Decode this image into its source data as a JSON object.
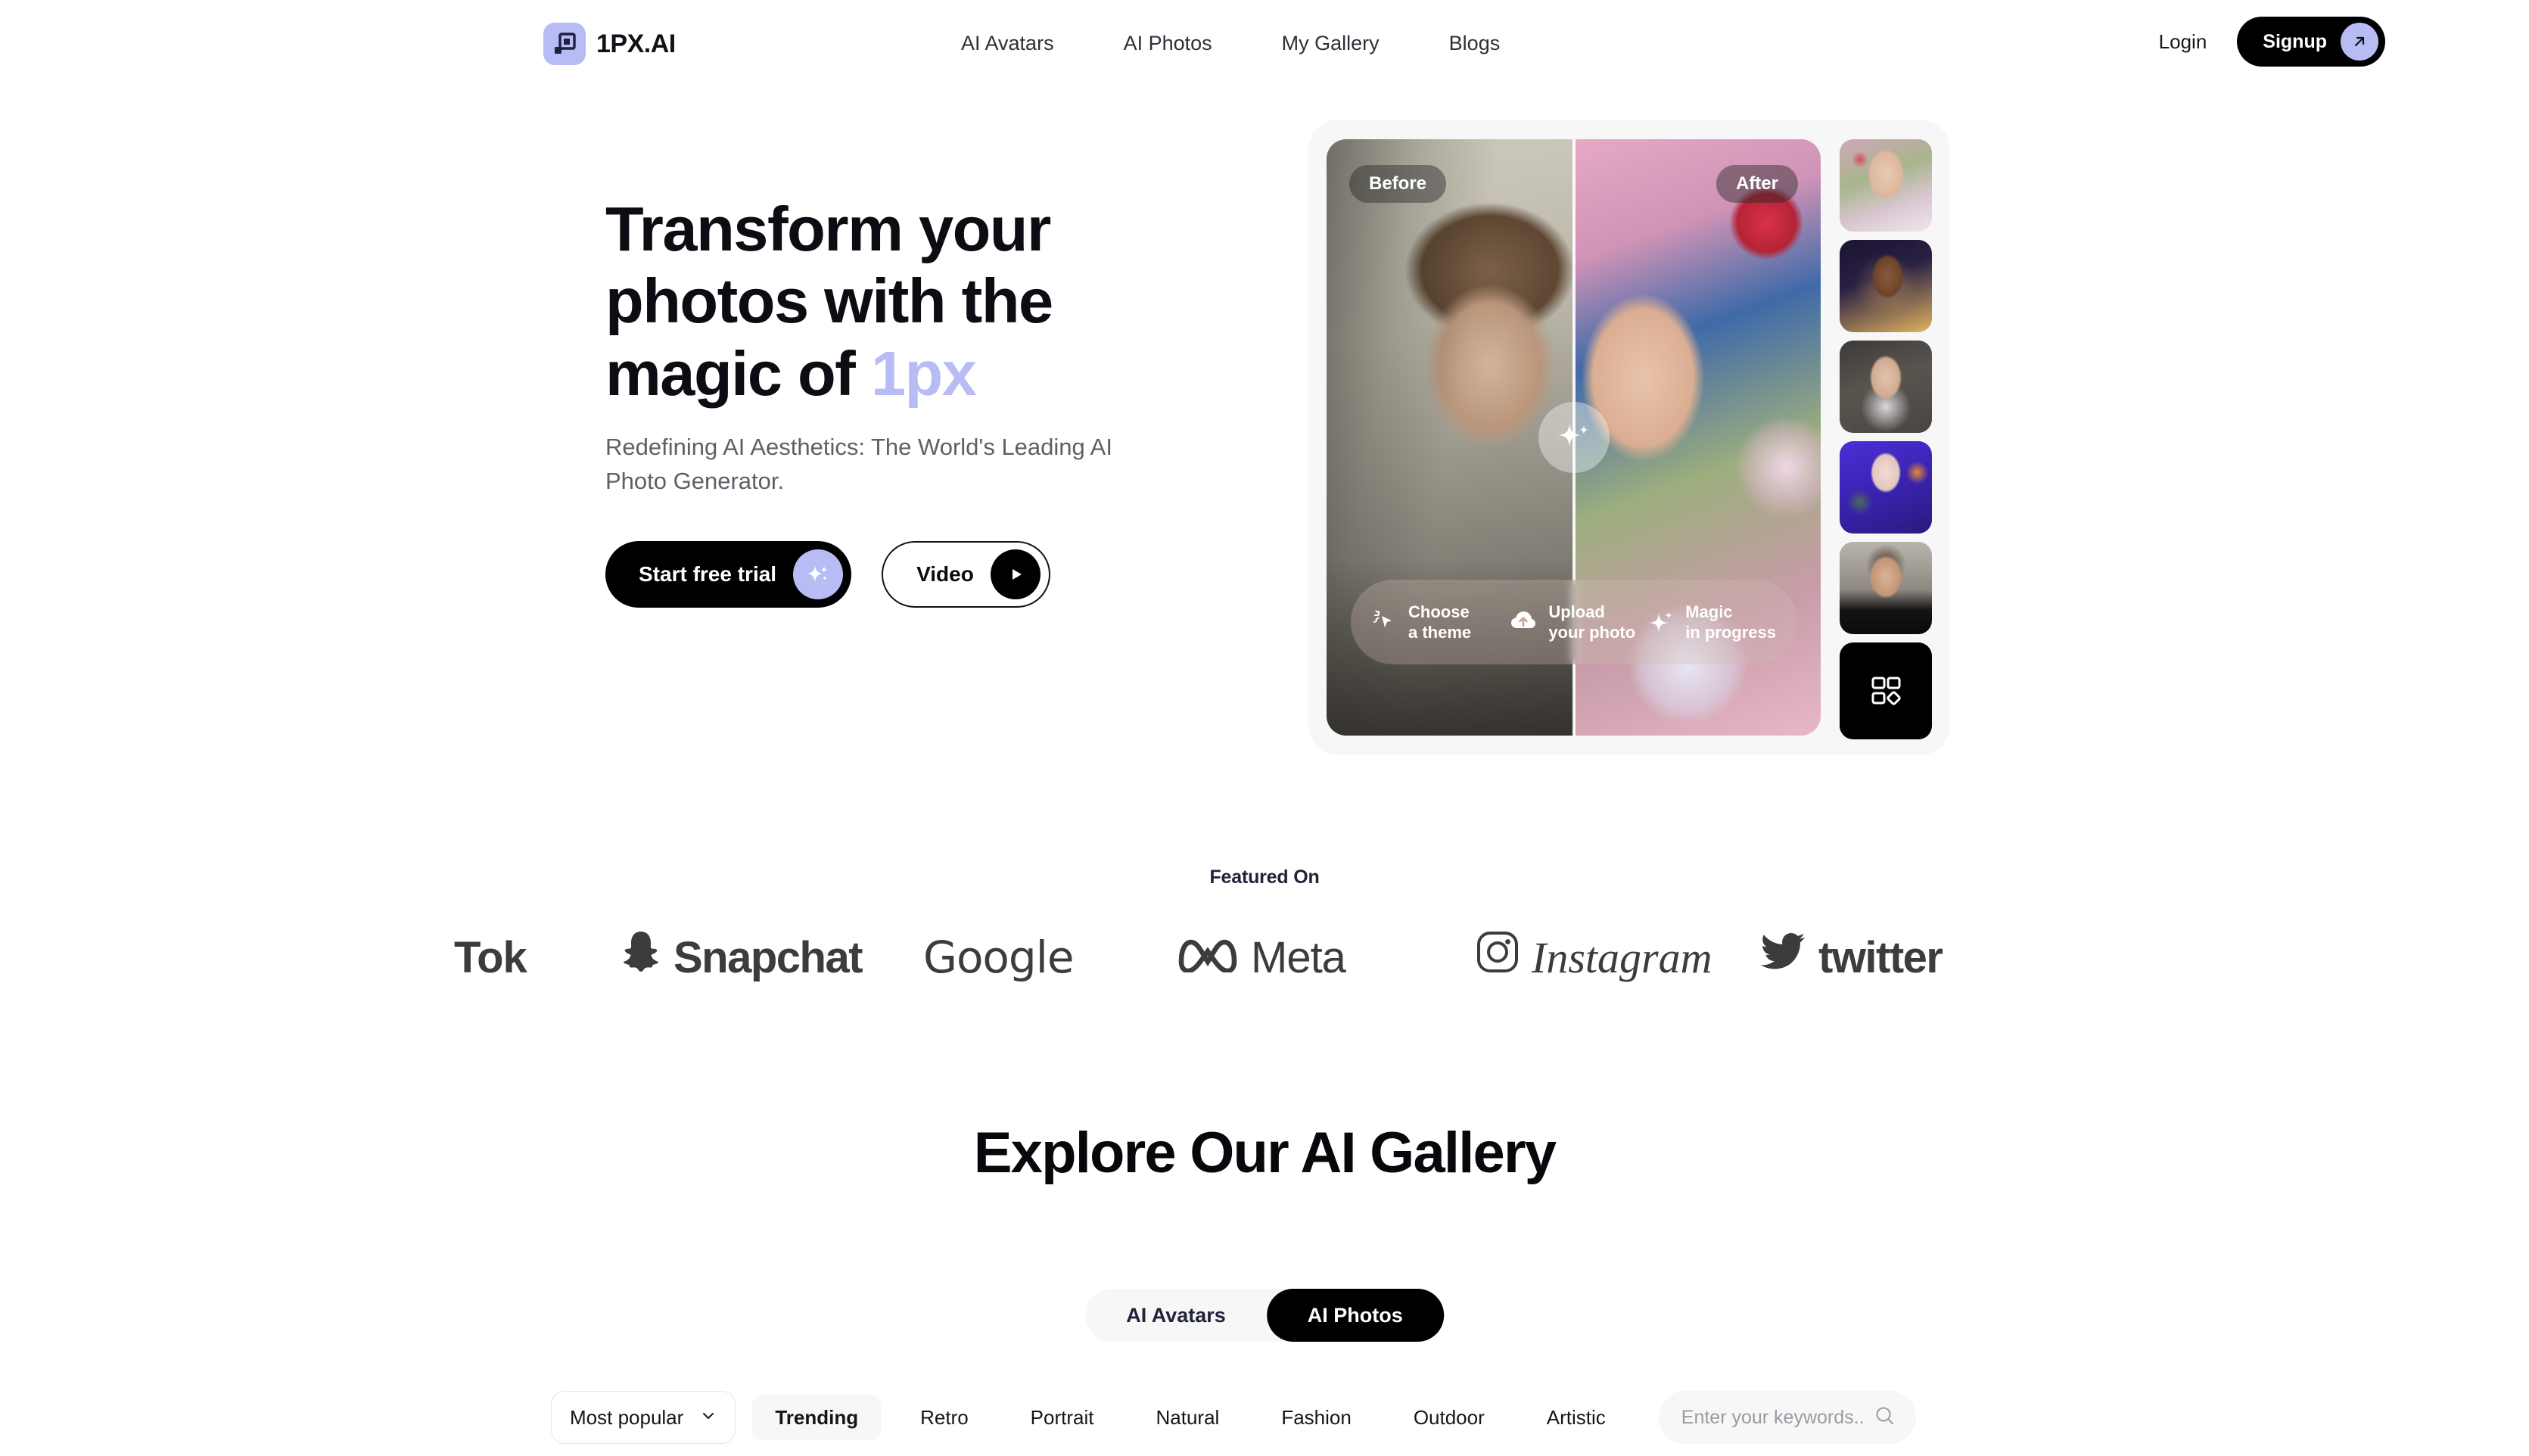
{
  "header": {
    "brand_name": "1PX.AI",
    "brand_icon": "squares-logo-icon",
    "nav": [
      {
        "label": "AI Avatars"
      },
      {
        "label": "AI Photos"
      },
      {
        "label": "My Gallery"
      },
      {
        "label": "Blogs"
      }
    ],
    "login_label": "Login",
    "signup_label": "Signup",
    "signup_icon": "arrow-up-right-icon",
    "brand_color": "#b7bcf5"
  },
  "hero": {
    "title_line1": "Transform your",
    "title_line2": "photos with the",
    "title_line3_prefix": "magic of ",
    "title_accent": "1px",
    "subtitle": "Redefining AI Aesthetics: The World's Leading AI Photo Generator.",
    "cta_primary": "Start free trial",
    "cta_primary_icon": "sparkle-icon",
    "cta_secondary": "Video",
    "cta_secondary_icon": "play-icon",
    "accent_color": "#b7bcf5"
  },
  "hero_panel": {
    "before_label": "Before",
    "after_label": "After",
    "slider_handle_icon": "sparkle-icon",
    "steps": [
      {
        "icon": "cursor-click-icon",
        "line1": "Choose",
        "line2": "a theme"
      },
      {
        "icon": "cloud-upload-icon",
        "line1": "Upload",
        "line2": "your photo"
      },
      {
        "icon": "sparkle-icon",
        "line1": "Magic",
        "line2": "in progress"
      }
    ],
    "thumbnails": [
      {
        "name": "thumbnail-floral-portrait"
      },
      {
        "name": "thumbnail-golden-portrait"
      },
      {
        "name": "thumbnail-bridal-portrait"
      },
      {
        "name": "thumbnail-anime-portrait"
      },
      {
        "name": "thumbnail-male-portrait"
      }
    ],
    "more_button_icon": "grid-shapes-icon"
  },
  "featured": {
    "label": "Featured On",
    "logos": [
      {
        "name": "tiktok-logo",
        "text": "Tok",
        "icon": ""
      },
      {
        "name": "snapchat-logo",
        "text": "Snapchat",
        "icon": "ghost-icon"
      },
      {
        "name": "google-logo",
        "text": "Google",
        "icon": ""
      },
      {
        "name": "meta-logo",
        "text": "Meta",
        "icon": "infinity-icon"
      },
      {
        "name": "instagram-logo",
        "text": "Instagram",
        "icon": "camera-icon"
      },
      {
        "name": "twitter-logo",
        "text": "twitter",
        "icon": "bird-icon"
      }
    ]
  },
  "gallery": {
    "title": "Explore Our AI Gallery",
    "tabs": [
      {
        "label": "AI Avatars",
        "active": false
      },
      {
        "label": "AI Photos",
        "active": true
      }
    ],
    "sort": {
      "value": "Most popular",
      "icon": "chevron-down-icon"
    },
    "filters": [
      {
        "label": "Trending",
        "active": true
      },
      {
        "label": "Retro",
        "active": false
      },
      {
        "label": "Portrait",
        "active": false
      },
      {
        "label": "Natural",
        "active": false
      },
      {
        "label": "Fashion",
        "active": false
      },
      {
        "label": "Outdoor",
        "active": false
      },
      {
        "label": "Artistic",
        "active": false
      }
    ],
    "search": {
      "placeholder": "Enter your keywords...",
      "value": "",
      "icon": "search-icon"
    }
  }
}
